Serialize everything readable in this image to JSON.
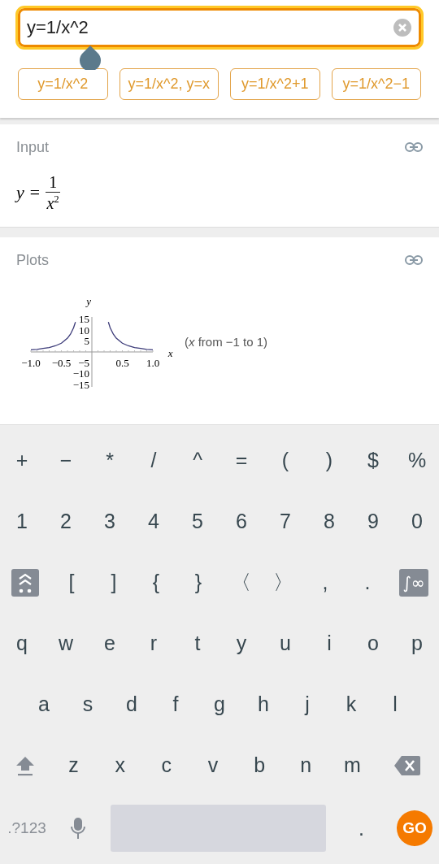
{
  "query": {
    "value": "y=1/x^2"
  },
  "suggestions": [
    "y=1/x^2",
    "y=1/x^2, y=x",
    "y=1/x^2+1",
    "y=1/x^2−1"
  ],
  "input_section": {
    "title": "Input",
    "lhs": "y =",
    "numerator": "1",
    "denominator": "x",
    "exponent": "2"
  },
  "plots_section": {
    "title": "Plots",
    "caption": "(*x* from −1 to 1)",
    "chart_data": {
      "type": "line",
      "xlabel": "x",
      "ylabel": "y",
      "x": [
        -1,
        -0.9,
        -0.8,
        -0.7,
        -0.6,
        -0.5,
        -0.4,
        -0.35,
        -0.3,
        -0.27,
        -0.25,
        0,
        0.25,
        0.27,
        0.3,
        0.35,
        0.4,
        0.5,
        0.6,
        0.7,
        0.8,
        0.9,
        1
      ],
      "series": [
        {
          "color": "#3b3a78",
          "values": [
            1,
            1.2,
            1.6,
            2,
            2.8,
            4,
            6.3,
            8.2,
            11.1,
            13.7,
            null,
            null,
            null,
            13.7,
            11.1,
            8.2,
            6.3,
            4,
            2.8,
            2,
            1.6,
            1.2,
            1
          ]
        }
      ],
      "xlim": [
        -1,
        1
      ],
      "ylim": [
        -16,
        16
      ],
      "xticks": [
        {
          "value": -1,
          "label": "−1.0"
        },
        {
          "value": -0.5,
          "label": "−0.5"
        },
        {
          "value": 0.5,
          "label": "0.5"
        },
        {
          "value": 1,
          "label": "1.0"
        }
      ],
      "yticks": [
        {
          "value": 15,
          "label": "15"
        },
        {
          "value": 10,
          "label": "10"
        },
        {
          "value": 5,
          "label": "5"
        },
        {
          "value": -5,
          "label": "−5"
        },
        {
          "value": -10,
          "label": "−10"
        },
        {
          "value": -15,
          "label": "−15"
        }
      ]
    }
  },
  "keyboard": {
    "rows": [
      {
        "kind": "grid",
        "keys": [
          {
            "kind": "char",
            "label": "+"
          },
          {
            "kind": "char",
            "label": "−"
          },
          {
            "kind": "char",
            "label": "*"
          },
          {
            "kind": "char",
            "label": "/"
          },
          {
            "kind": "char",
            "label": "^"
          },
          {
            "kind": "char",
            "label": "="
          },
          {
            "kind": "char",
            "label": "("
          },
          {
            "kind": "char",
            "label": ")"
          },
          {
            "kind": "char",
            "label": "$"
          },
          {
            "kind": "char",
            "label": "%"
          }
        ]
      },
      {
        "kind": "grid",
        "keys": [
          {
            "kind": "char",
            "label": "1"
          },
          {
            "kind": "char",
            "label": "2"
          },
          {
            "kind": "char",
            "label": "3"
          },
          {
            "kind": "char",
            "label": "4"
          },
          {
            "kind": "char",
            "label": "5"
          },
          {
            "kind": "char",
            "label": "6"
          },
          {
            "kind": "char",
            "label": "7"
          },
          {
            "kind": "char",
            "label": "8"
          },
          {
            "kind": "char",
            "label": "9"
          },
          {
            "kind": "char",
            "label": "0"
          }
        ]
      },
      {
        "kind": "edges",
        "keys": [
          {
            "kind": "layout"
          },
          {
            "kind": "char",
            "label": "["
          },
          {
            "kind": "char",
            "label": "]"
          },
          {
            "kind": "char",
            "label": "{"
          },
          {
            "kind": "char",
            "label": "}"
          },
          {
            "kind": "char",
            "label": "〈"
          },
          {
            "kind": "char",
            "label": "〉"
          },
          {
            "kind": "char",
            "label": ","
          },
          {
            "kind": "char",
            "label": "."
          },
          {
            "kind": "special",
            "label": "∫∞"
          }
        ]
      },
      {
        "kind": "grid",
        "keys": [
          {
            "kind": "char",
            "label": "q"
          },
          {
            "kind": "char",
            "label": "w"
          },
          {
            "kind": "char",
            "label": "e"
          },
          {
            "kind": "char",
            "label": "r"
          },
          {
            "kind": "char",
            "label": "t"
          },
          {
            "kind": "char",
            "label": "y"
          },
          {
            "kind": "char",
            "label": "u"
          },
          {
            "kind": "char",
            "label": "i"
          },
          {
            "kind": "char",
            "label": "o"
          },
          {
            "kind": "char",
            "label": "p"
          }
        ]
      },
      {
        "kind": "inset",
        "keys": [
          {
            "kind": "char",
            "label": "a"
          },
          {
            "kind": "char",
            "label": "s"
          },
          {
            "kind": "char",
            "label": "d"
          },
          {
            "kind": "char",
            "label": "f"
          },
          {
            "kind": "char",
            "label": "g"
          },
          {
            "kind": "char",
            "label": "h"
          },
          {
            "kind": "char",
            "label": "j"
          },
          {
            "kind": "char",
            "label": "k"
          },
          {
            "kind": "char",
            "label": "l"
          }
        ]
      },
      {
        "kind": "edges",
        "keys": [
          {
            "kind": "shift"
          },
          {
            "kind": "char",
            "label": "z"
          },
          {
            "kind": "char",
            "label": "x"
          },
          {
            "kind": "char",
            "label": "c"
          },
          {
            "kind": "char",
            "label": "v"
          },
          {
            "kind": "char",
            "label": "b"
          },
          {
            "kind": "char",
            "label": "n"
          },
          {
            "kind": "char",
            "label": "m"
          },
          {
            "kind": "backspace"
          }
        ]
      },
      {
        "kind": "bottom",
        "keys": [
          {
            "kind": "mode",
            "label": ".?123"
          },
          {
            "kind": "mic"
          },
          {
            "kind": "space"
          },
          {
            "kind": "char",
            "label": "."
          },
          {
            "kind": "go",
            "label": "GO"
          }
        ]
      }
    ]
  }
}
